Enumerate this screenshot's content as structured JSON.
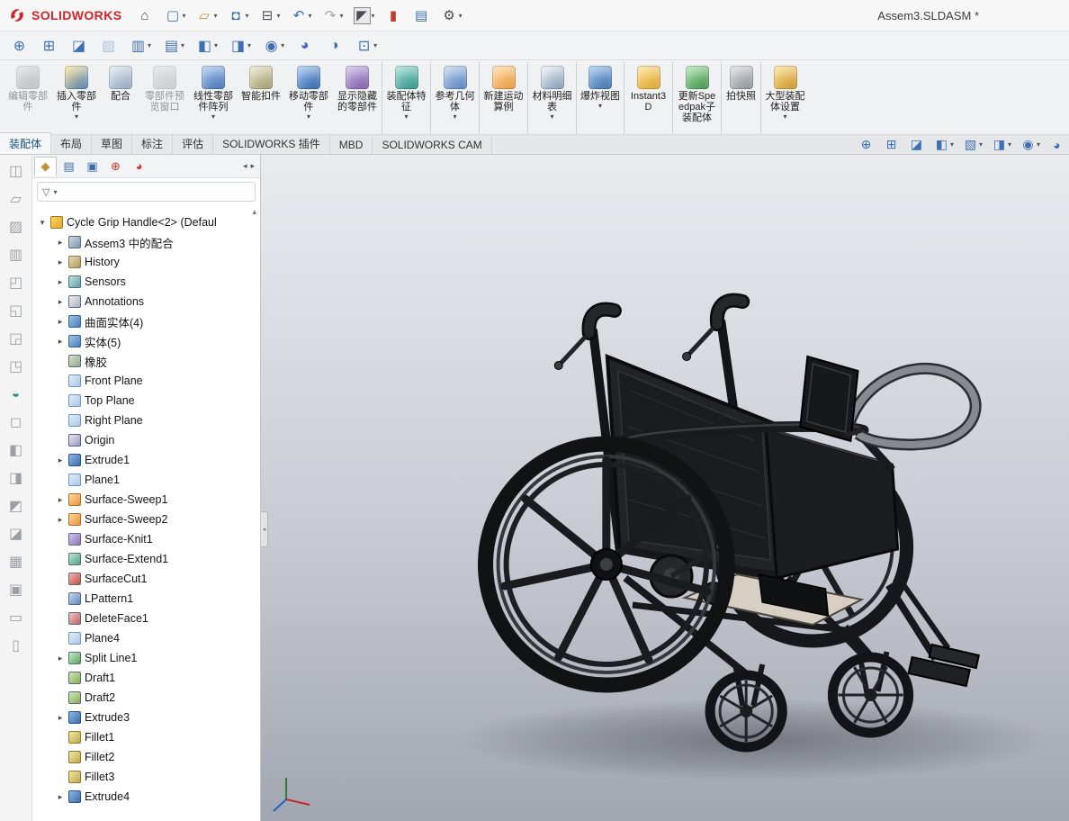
{
  "window": {
    "brand": "SOLIDWORKS",
    "title": "Assem3.SLDASM *"
  },
  "titlebar": {
    "icons": [
      {
        "name": "home-icon",
        "glyph": "⌂",
        "classes": "c-dark",
        "caret": ""
      },
      {
        "name": "new-document-icon",
        "glyph": "▢",
        "classes": "c-blue",
        "caret": "▾"
      },
      {
        "name": "open-icon",
        "glyph": "▱",
        "classes": "c-gold",
        "caret": "▾"
      },
      {
        "name": "save-icon",
        "glyph": "◘",
        "classes": "c-blue",
        "caret": "▾"
      },
      {
        "name": "print-icon",
        "glyph": "⊟",
        "classes": "c-dark",
        "caret": "▾"
      },
      {
        "name": "undo-icon",
        "glyph": "↶",
        "classes": "c-blue",
        "caret": "▾"
      },
      {
        "name": "redo-icon",
        "glyph": "↷",
        "classes": "disabled",
        "caret": "▾"
      },
      {
        "name": "select-tool-icon",
        "glyph": "◤",
        "classes": "boxed c-dark",
        "caret": "▾"
      },
      {
        "name": "utility-icon",
        "glyph": "▮",
        "classes": "c-red",
        "caret": ""
      },
      {
        "name": "task-list-icon",
        "glyph": "▤",
        "classes": "c-blue",
        "caret": ""
      },
      {
        "name": "options-icon",
        "glyph": "⚙",
        "classes": "c-dark",
        "caret": "▾"
      }
    ]
  },
  "quickbar": {
    "icons": [
      {
        "name": "zoom-fit-icon",
        "glyph": "⊕",
        "classes": "",
        "caret": ""
      },
      {
        "name": "zoom-area-icon",
        "glyph": "⊞",
        "classes": "",
        "caret": ""
      },
      {
        "name": "erase-marks-icon",
        "glyph": "◪",
        "classes": "c-dark",
        "caret": ""
      },
      {
        "name": "screenshot-icon",
        "glyph": "▨",
        "classes": "disabled",
        "caret": ""
      },
      {
        "name": "pages-icon",
        "glyph": "▥",
        "classes": "",
        "caret": "▾"
      },
      {
        "name": "report-icon",
        "glyph": "▤",
        "classes": "",
        "caret": "▾"
      },
      {
        "name": "section-view-icon",
        "glyph": "◧",
        "classes": "",
        "caret": "▾"
      },
      {
        "name": "view-orientation-icon",
        "glyph": "◨",
        "classes": "",
        "caret": "▾"
      },
      {
        "name": "display-style-icon",
        "glyph": "◉",
        "classes": "",
        "caret": "▾"
      },
      {
        "name": "appearance-icon",
        "glyph": "◕",
        "classes": "c-red",
        "caret": ""
      },
      {
        "name": "scene-icon",
        "glyph": "◑",
        "classes": "c-gold",
        "caret": ""
      },
      {
        "name": "view-settings-icon",
        "glyph": "⊡",
        "classes": "",
        "caret": "▾"
      }
    ]
  },
  "ribbon": {
    "buttons": [
      {
        "label": "编辑零部件",
        "icon": "ric-edit",
        "classes": "disabled",
        "caret": ""
      },
      {
        "label": "插入零部件",
        "icon": "ric-insert",
        "classes": "",
        "caret": "▾"
      },
      {
        "label": "配合",
        "icon": "ric-mate",
        "classes": "",
        "caret": ""
      },
      {
        "label": "零部件预览窗口",
        "icon": "ric-preview",
        "classes": "disabled",
        "caret": ""
      },
      {
        "label": "线性零部件阵列",
        "icon": "ric-pattern",
        "classes": "",
        "caret": "▾"
      },
      {
        "label": "智能扣件",
        "icon": "ric-fastener",
        "classes": "",
        "caret": ""
      },
      {
        "label": "移动零部件",
        "icon": "ric-move",
        "classes": "",
        "caret": "▾"
      },
      {
        "label": "显示隐藏的零部件",
        "icon": "ric-showhide",
        "classes": "",
        "caret": ""
      },
      {
        "label": "装配体特征",
        "icon": "ric-asmfeat",
        "classes": "sep",
        "caret": "▾"
      },
      {
        "label": "参考几何体",
        "icon": "ric-refgeo",
        "classes": "sep",
        "caret": "▾"
      },
      {
        "label": "新建运动算例",
        "icon": "ric-motion",
        "classes": "sep",
        "caret": ""
      },
      {
        "label": "材料明细表",
        "icon": "ric-bom",
        "classes": "sep",
        "caret": "▾"
      },
      {
        "label": "爆炸视图",
        "icon": "ric-explode",
        "classes": "sep",
        "caret": "▾"
      },
      {
        "label": "Instant3D",
        "icon": "ric-instant3d",
        "classes": "sep",
        "caret": ""
      },
      {
        "label": "更新Speedpak子装配体",
        "icon": "ric-speedpak",
        "classes": "sep",
        "caret": ""
      },
      {
        "label": "拍快照",
        "icon": "ric-snapshot",
        "classes": "sep",
        "caret": ""
      },
      {
        "label": "大型装配体设置",
        "icon": "ric-largeasm",
        "classes": "sep",
        "caret": "▾"
      }
    ]
  },
  "tabs": {
    "items": [
      {
        "label": "装配体",
        "classes": "active"
      },
      {
        "label": "布局",
        "classes": ""
      },
      {
        "label": "草图",
        "classes": ""
      },
      {
        "label": "标注",
        "classes": ""
      },
      {
        "label": "评估",
        "classes": ""
      },
      {
        "label": "SOLIDWORKS 插件",
        "classes": ""
      },
      {
        "label": "MBD",
        "classes": ""
      },
      {
        "label": "SOLIDWORKS CAM",
        "classes": ""
      }
    ],
    "right_icons": [
      {
        "name": "zoom-fit-icon",
        "glyph": "⊕",
        "classes": "",
        "caret": ""
      },
      {
        "name": "zoom-area-icon",
        "glyph": "⊞",
        "classes": "",
        "caret": ""
      },
      {
        "name": "erase-marks-icon",
        "glyph": "◪",
        "classes": "c-dark",
        "caret": ""
      },
      {
        "name": "section-view-icon",
        "glyph": "◧",
        "classes": "",
        "caret": "▾"
      },
      {
        "name": "annotation-view-icon",
        "glyph": "▧",
        "classes": "",
        "caret": "▾"
      },
      {
        "name": "view-orientation-icon",
        "glyph": "◨",
        "classes": "",
        "caret": "▾"
      },
      {
        "name": "display-style-icon",
        "glyph": "◉",
        "classes": "",
        "caret": "▾"
      },
      {
        "name": "appearance-icon",
        "glyph": "◕",
        "classes": "c-red",
        "caret": ""
      }
    ]
  },
  "leftstrip": {
    "items": [
      {
        "name": "assembly-tool-icon",
        "glyph": "◫",
        "classes": "lg"
      },
      {
        "name": "assembly-tool-icon",
        "glyph": "▱",
        "classes": "lg"
      },
      {
        "name": "assembly-tool-icon",
        "glyph": "▨",
        "classes": "lg"
      },
      {
        "name": "assembly-tool-icon",
        "glyph": "▥",
        "classes": "lg"
      },
      {
        "name": "assembly-tool-icon",
        "glyph": "◰",
        "classes": "lg"
      },
      {
        "name": "assembly-tool-icon",
        "glyph": "◱",
        "classes": "lg"
      },
      {
        "name": "assembly-tool-icon",
        "glyph": "◲",
        "classes": "lg"
      },
      {
        "name": "assembly-tool-icon",
        "glyph": "◳",
        "classes": "lg"
      },
      {
        "name": "assembly-tool-icon",
        "glyph": "◒",
        "classes": "teal"
      },
      {
        "name": "assembly-tool-icon",
        "glyph": "◻",
        "classes": "lg"
      },
      {
        "name": "assembly-tool-icon",
        "glyph": "◧",
        "classes": "lg"
      },
      {
        "name": "assembly-tool-icon",
        "glyph": "◨",
        "classes": "lg"
      },
      {
        "name": "assembly-tool-icon",
        "glyph": "◩",
        "classes": "lg"
      },
      {
        "name": "assembly-tool-icon",
        "glyph": "◪",
        "classes": "lg"
      },
      {
        "name": "assembly-tool-icon",
        "glyph": "▦",
        "classes": "lg"
      },
      {
        "name": "assembly-tool-icon",
        "glyph": "▣",
        "classes": "lg"
      },
      {
        "name": "assembly-tool-icon",
        "glyph": "▭",
        "classes": "lg"
      },
      {
        "name": "assembly-tool-icon",
        "glyph": "▯",
        "classes": "lg"
      }
    ]
  },
  "panel": {
    "tabs": [
      {
        "name": "featuremanager-tab",
        "glyph": "◆",
        "classes": "active c-gold"
      },
      {
        "name": "propertymanager-tab",
        "glyph": "▤",
        "classes": "c-blue"
      },
      {
        "name": "configurationmanager-tab",
        "glyph": "▣",
        "classes": "c-blue"
      },
      {
        "name": "dimxpertmanager-tab",
        "glyph": "⊕",
        "classes": "c-red"
      },
      {
        "name": "displaymanager-tab",
        "glyph": "◕",
        "classes": "c-red"
      }
    ],
    "tab_arrows": {
      "left": "◂",
      "right": "▸"
    },
    "filter": {
      "funnel": "▽",
      "caret": "▾"
    },
    "scroll_up": "▴"
  },
  "tree": {
    "items": [
      {
        "label": "Cycle Grip Handle<2> (Defaul",
        "icon": "ic-asm",
        "arrow": "▾",
        "classes": "d0"
      },
      {
        "label": "Assem3 中的配合",
        "icon": "ic-mates",
        "arrow": "▸",
        "classes": "d1"
      },
      {
        "label": "History",
        "icon": "ic-history",
        "arrow": "▸",
        "classes": "d1"
      },
      {
        "label": "Sensors",
        "icon": "ic-sensors",
        "arrow": "▸",
        "classes": "d1"
      },
      {
        "label": "Annotations",
        "icon": "ic-annot",
        "arrow": "▸",
        "classes": "d1"
      },
      {
        "label": "曲面实体(4)",
        "icon": "ic-folder",
        "arrow": "▸",
        "classes": "d1"
      },
      {
        "label": "实体(5)",
        "icon": "ic-folder",
        "arrow": "▸",
        "classes": "d1"
      },
      {
        "label": "橡胶",
        "icon": "ic-material",
        "arrow": "",
        "classes": "d1"
      },
      {
        "label": "Front Plane",
        "icon": "ic-plane",
        "arrow": "",
        "classes": "d1"
      },
      {
        "label": "Top Plane",
        "icon": "ic-plane",
        "arrow": "",
        "classes": "d1"
      },
      {
        "label": "Right Plane",
        "icon": "ic-plane",
        "arrow": "",
        "classes": "d1"
      },
      {
        "label": "Origin",
        "icon": "ic-origin",
        "arrow": "",
        "classes": "d1"
      },
      {
        "label": "Extrude1",
        "icon": "ic-extrude",
        "arrow": "▸",
        "classes": "d1"
      },
      {
        "label": "Plane1",
        "icon": "ic-plane",
        "arrow": "",
        "classes": "d1"
      },
      {
        "label": "Surface-Sweep1",
        "icon": "ic-sweep",
        "arrow": "▸",
        "classes": "d1"
      },
      {
        "label": "Surface-Sweep2",
        "icon": "ic-sweep",
        "arrow": "▸",
        "classes": "d1"
      },
      {
        "label": "Surface-Knit1",
        "icon": "ic-knit",
        "arrow": "",
        "classes": "d1"
      },
      {
        "label": "Surface-Extend1",
        "icon": "ic-extend",
        "arrow": "",
        "classes": "d1"
      },
      {
        "label": "SurfaceCut1",
        "icon": "ic-surfcut",
        "arrow": "",
        "classes": "d1"
      },
      {
        "label": "LPattern1",
        "icon": "ic-lpattern",
        "arrow": "",
        "classes": "d1"
      },
      {
        "label": "DeleteFace1",
        "icon": "ic-delface",
        "arrow": "",
        "classes": "d1"
      },
      {
        "label": "Plane4",
        "icon": "ic-plane",
        "arrow": "",
        "classes": "d1"
      },
      {
        "label": "Split Line1",
        "icon": "ic-splitline",
        "arrow": "▸",
        "classes": "d1"
      },
      {
        "label": "Draft1",
        "icon": "ic-draft",
        "arrow": "",
        "classes": "d1"
      },
      {
        "label": "Draft2",
        "icon": "ic-draft",
        "arrow": "",
        "classes": "d1"
      },
      {
        "label": "Extrude3",
        "icon": "ic-extrude",
        "arrow": "▸",
        "classes": "d1"
      },
      {
        "label": "Fillet1",
        "icon": "ic-fillet",
        "arrow": "",
        "classes": "d1"
      },
      {
        "label": "Fillet2",
        "icon": "ic-fillet",
        "arrow": "",
        "classes": "d1"
      },
      {
        "label": "Fillet3",
        "icon": "ic-fillet",
        "arrow": "",
        "classes": "d1"
      },
      {
        "label": "Extrude4",
        "icon": "ic-extrude",
        "arrow": "▸",
        "classes": "d1"
      }
    ]
  },
  "viewport": {
    "bg_top": "#eaebef",
    "bg_bottom": "#a2a6b0"
  }
}
